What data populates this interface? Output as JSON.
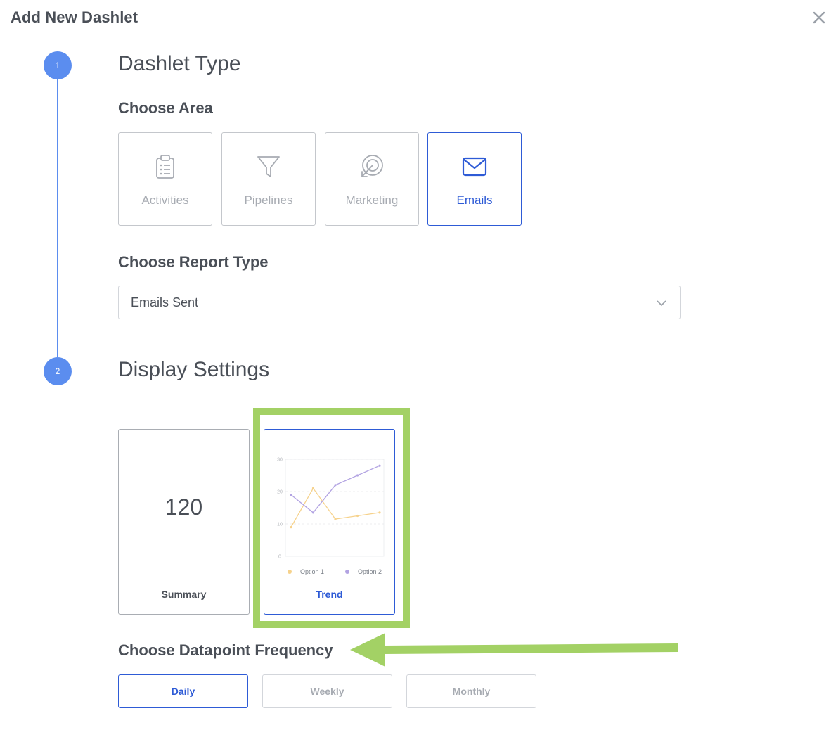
{
  "dialog": {
    "title": "Add New Dashlet"
  },
  "steps": [
    {
      "number": "1",
      "title": "Dashlet Type"
    },
    {
      "number": "2",
      "title": "Display Settings"
    }
  ],
  "choose_area": {
    "heading": "Choose Area",
    "options": [
      {
        "label": "Activities",
        "icon": "clipboard-icon",
        "selected": false
      },
      {
        "label": "Pipelines",
        "icon": "funnel-icon",
        "selected": false
      },
      {
        "label": "Marketing",
        "icon": "target-icon",
        "selected": false
      },
      {
        "label": "Emails",
        "icon": "envelope-icon",
        "selected": true
      }
    ]
  },
  "report_type": {
    "heading": "Choose Report Type",
    "selected": "Emails Sent"
  },
  "display_options": {
    "summary": {
      "value": "120",
      "label": "Summary"
    },
    "trend": {
      "label": "Trend",
      "selected": true
    }
  },
  "chart_data": {
    "type": "line",
    "x": [
      1,
      2,
      3,
      4,
      5
    ],
    "series": [
      {
        "name": "Option 1",
        "values": [
          9,
          21,
          11.5,
          12.5,
          13.5
        ],
        "color": "#f6d28c"
      },
      {
        "name": "Option 2",
        "values": [
          19,
          13.5,
          22,
          25,
          28
        ],
        "color": "#b2a3e2"
      }
    ],
    "yticks": [
      "0",
      "10",
      "20",
      "30"
    ],
    "ylim": [
      0,
      30
    ],
    "grid": true,
    "legend": "bottom"
  },
  "frequency": {
    "heading": "Choose Datapoint Frequency",
    "options": [
      {
        "label": "Daily",
        "selected": true
      },
      {
        "label": "Weekly",
        "selected": false
      },
      {
        "label": "Monthly",
        "selected": false
      }
    ]
  },
  "colors": {
    "accent": "#2e5bd6",
    "step": "#5b8def",
    "highlight": "#a3d165"
  }
}
